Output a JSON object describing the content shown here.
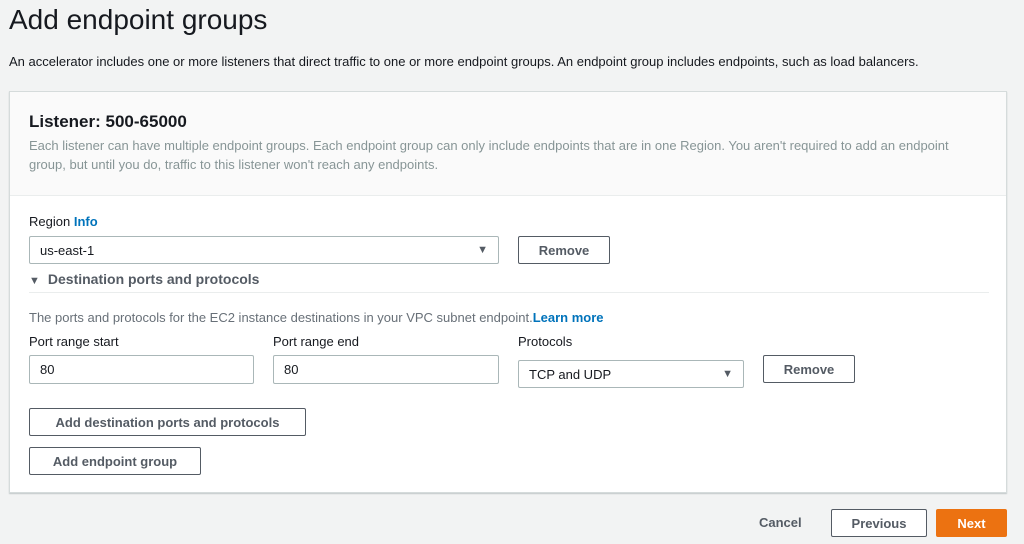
{
  "title": "Add endpoint groups",
  "intro": "An accelerator includes one or more listeners that direct traffic to one or more endpoint groups. An endpoint group includes endpoints, such as load balancers.",
  "listener": {
    "title": "Listener: 500-65000",
    "description": "Each listener can have multiple endpoint groups. Each endpoint group can only include endpoints that are in one Region. You aren't required to add an endpoint group, but until you do, traffic to this listener won't reach any endpoints.",
    "region_label": "Region",
    "info_link": "Info",
    "region_value": "us-east-1",
    "remove_label": "Remove",
    "section_title": "Destination ports and protocols",
    "section_desc": "The ports and protocols for the EC2 instance destinations in your VPC subnet endpoint.",
    "learn_more": "Learn more",
    "port_start_label": "Port range start",
    "port_start_value": "80",
    "port_end_label": "Port range end",
    "port_end_value": "80",
    "protocols_label": "Protocols",
    "protocols_value": "TCP and UDP",
    "remove_ports_label": "Remove",
    "add_ports_label": "Add destination ports and protocols",
    "add_group_label": "Add endpoint group"
  },
  "footer": {
    "cancel": "Cancel",
    "previous": "Previous",
    "next": "Next"
  },
  "colors": {
    "accent": "#ec7211",
    "link": "#0073bb"
  }
}
